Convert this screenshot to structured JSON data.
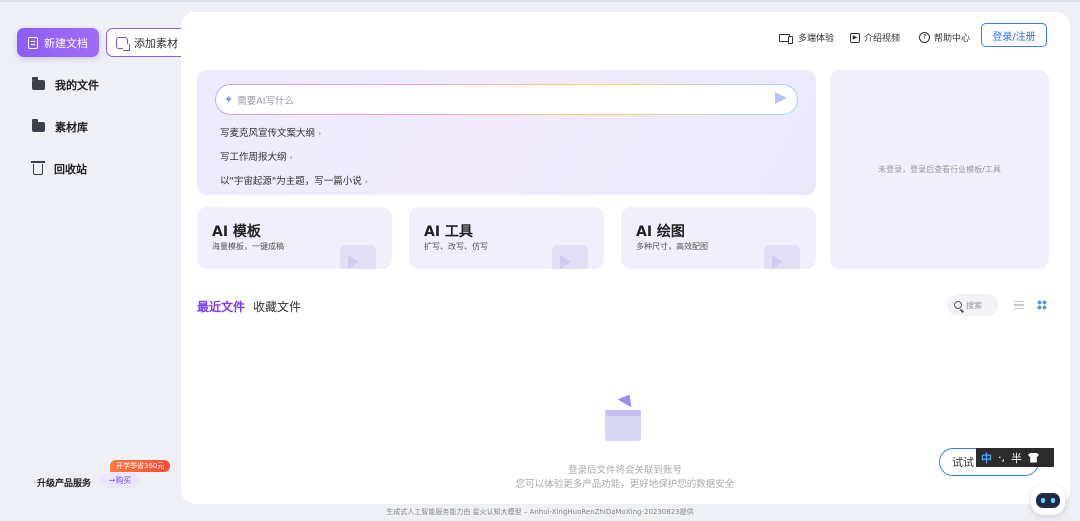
{
  "sidebar": {
    "new_doc": "新建文档",
    "add_material": "添加素材",
    "items": [
      {
        "label": "我的文件",
        "icon": "folder-icon"
      },
      {
        "label": "素材库",
        "icon": "folder-icon"
      },
      {
        "label": "回收站",
        "icon": "trash-icon"
      }
    ],
    "upgrade_label": "升级产品服务",
    "promo_badge": "开学季省360元",
    "buy_label": "→购买"
  },
  "header": {
    "links": [
      {
        "label": "多端体验",
        "icon": "devices-icon"
      },
      {
        "label": "介绍视频",
        "icon": "play-icon"
      },
      {
        "label": "帮助中心",
        "icon": "help-icon"
      }
    ],
    "login": "登录/注册"
  },
  "prompt": {
    "placeholder": "需要AI写什么",
    "suggestions": [
      "写麦克风宣传文案大纲",
      "写工作周报大纲",
      "以\"宇宙起源\"为主题，写一篇小说"
    ],
    "arrow": "›"
  },
  "side_panel": {
    "text": "未登录，登录后查看行业模板/工具"
  },
  "tools": [
    {
      "title": "AI 模板",
      "subtitle": "海量模板，一键成稿"
    },
    {
      "title": "AI 工具",
      "subtitle": "扩写、改写、仿写"
    },
    {
      "title": "AI 绘图",
      "subtitle": "多种尺寸，高效配图"
    }
  ],
  "files": {
    "tab_recent": "最近文件",
    "tab_favorites": "收藏文件",
    "search_placeholder": "搜索",
    "empty_line1": "登录后文件将会关联到账号",
    "empty_line2": "您可以体验更多产品功能，更好地保护您的数据安全"
  },
  "try_button": "试试",
  "ime": {
    "mode": "中",
    "punct": "·,",
    "width": "半"
  },
  "footer": "生成式人工智能服务能力由 星火认知大模型 – Anhui-XingHuoRenZhiDaMoXing-20230823提供",
  "colors": {
    "accent": "#8d5cf6",
    "link_blue": "#3a7bff"
  }
}
